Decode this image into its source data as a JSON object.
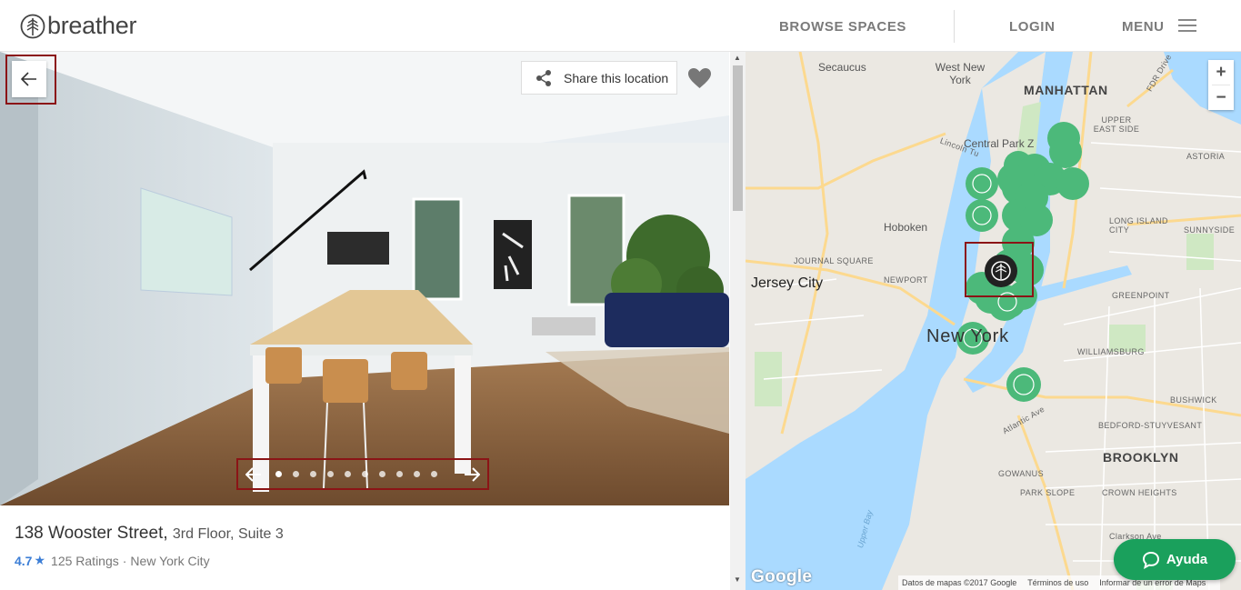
{
  "header": {
    "brand": "breather",
    "nav": {
      "browse": "BROWSE SPACES",
      "login": "LOGIN",
      "menu": "MENU"
    }
  },
  "photo": {
    "share_label": "Share this location",
    "carousel": {
      "total_slides": 10,
      "current_slide": 1
    }
  },
  "listing": {
    "address": "138 Wooster Street,",
    "address_detail": "3rd Floor, Suite 3",
    "rating": "4.7",
    "star": "★",
    "ratings_count": "125 Ratings",
    "separator": "·",
    "city": "New York City"
  },
  "map": {
    "zoom_in": "+",
    "zoom_out": "−",
    "labels": {
      "secaucus": "Secaucus",
      "west_new_york": "West New York",
      "manhattan": "MANHATTAN",
      "upper_east_side": "UPPER EAST SIDE",
      "central_park": "Central Park Z",
      "astoria": "ASTORIA",
      "hoboken": "Hoboken",
      "long_island_city": "LONG ISLAND CITY",
      "sunnyside": "SUNNYSIDE",
      "journal_square": "JOURNAL SQUARE",
      "jersey_city": "Jersey City",
      "newport": "NEWPORT",
      "greenpoint": "GREENPOINT",
      "new_york": "New York",
      "williamsburg": "WILLIAMSBURG",
      "bushwick": "BUSHWICK",
      "bedford_stuyvesant": "BEDFORD-STUYVESANT",
      "brooklyn": "BROOKLYN",
      "gowanus": "GOWANUS",
      "park_slope": "PARK SLOPE",
      "crown_heights": "CROWN HEIGHTS",
      "clarkson": "Clarkson Ave",
      "upper_bay": "Upper Bay",
      "lincoln_tunnel": "Lincoln Tu",
      "fdr_drive": "FDR Drive",
      "atlantic_ave": "Atlantic Ave"
    },
    "google": "Google",
    "footer": {
      "data": "Datos de mapas ©2017 Google",
      "terms": "Términos de uso",
      "report": "Informar de un error de Maps"
    }
  },
  "help": {
    "label": "Ayuda"
  },
  "colors": {
    "accent_green": "#1aa05c",
    "pin_green": "#4cb97a",
    "rating_blue": "#3c7ed6",
    "highlight": "#8b1416"
  }
}
